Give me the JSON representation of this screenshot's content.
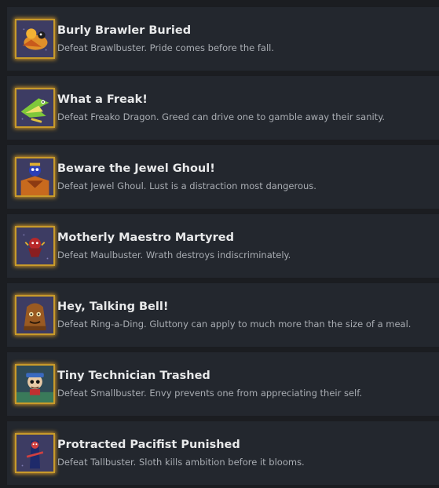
{
  "achievements": [
    {
      "title": "Burly Brawler Buried",
      "description": "Defeat Brawlbuster. Pride comes before the fall.",
      "icon": "brawlbuster-boss-icon"
    },
    {
      "title": "What a Freak!",
      "description": "Defeat Freako Dragon. Greed can drive one to gamble away their sanity.",
      "icon": "freako-dragon-boss-icon"
    },
    {
      "title": "Beware the Jewel Ghoul!",
      "description": "Defeat Jewel Ghoul. Lust is a distraction most dangerous.",
      "icon": "jewel-ghoul-boss-icon"
    },
    {
      "title": "Motherly Maestro Martyred",
      "description": "Defeat Maulbuster. Wrath destroys indiscriminately.",
      "icon": "maulbuster-boss-icon"
    },
    {
      "title": "Hey, Talking Bell!",
      "description": "Defeat Ring-a-Ding. Gluttony can apply to much more than the size of a meal.",
      "icon": "ring-a-ding-boss-icon"
    },
    {
      "title": "Tiny Technician Trashed",
      "description": "Defeat Smallbuster. Envy prevents one from appreciating their self.",
      "icon": "smallbuster-boss-icon"
    },
    {
      "title": "Protracted Pacifist Punished",
      "description": "Defeat Tallbuster. Sloth kills ambition before it blooms.",
      "icon": "tallbuster-boss-icon"
    }
  ],
  "colors": {
    "row_bg": "#23272e",
    "page_bg": "#1b1d21",
    "title": "#e8e9ea",
    "desc": "#a9adb3",
    "frame_gold": "#c89a2a"
  }
}
